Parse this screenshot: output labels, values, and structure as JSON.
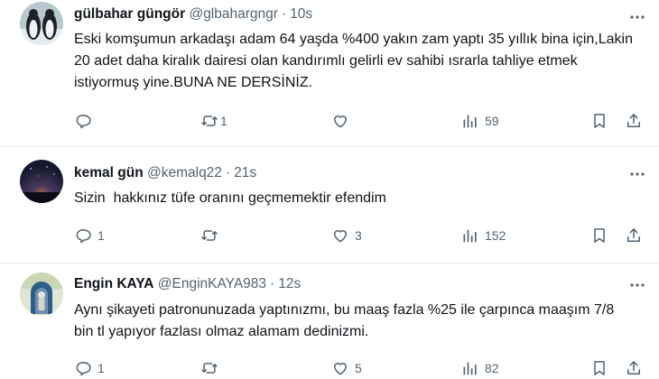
{
  "tweets": [
    {
      "name": "gülbahar güngör",
      "handle": "@glbahargngr",
      "time": "10s",
      "text": "Eski komşumun arkadaşı adam 64 yaşda %400 yakın zam yaptı 35 yıllık bina için,Lakin 20 adet daha kiralık dairesi olan kandırımlı gelirli ev sahibi ısrarla tahliye etmek istiyormuş yine.BUNA NE DERSİNİZ.",
      "replies": "",
      "retweets": "1",
      "likes": "",
      "views": "59",
      "avatar_icon": "penguins-avatar"
    },
    {
      "name": "kemal gün",
      "handle": "@kemalq22",
      "time": "21s",
      "text": "Sizin  hakkınız tüfe oranını geçmemektir efendim",
      "replies": "1",
      "retweets": "",
      "likes": "3",
      "views": "152",
      "avatar_icon": "night-sky-avatar"
    },
    {
      "name": "Engin KAYA",
      "handle": "@EnginKAYA983",
      "time": "12s",
      "text": "Aynı şikayeti patronunuzada yaptınızmı, bu maaş fazla %25 ile çarpınca maaşım 7/8 bin tl yapıyor fazlası olmaz alamam dedinizmi.",
      "replies": "1",
      "retweets": "",
      "likes": "5",
      "views": "82",
      "avatar_icon": "statue-avatar"
    }
  ],
  "separator": "·",
  "colors": {
    "text": "#0f1419",
    "secondary": "#536471",
    "divider": "#e6ecf0"
  }
}
